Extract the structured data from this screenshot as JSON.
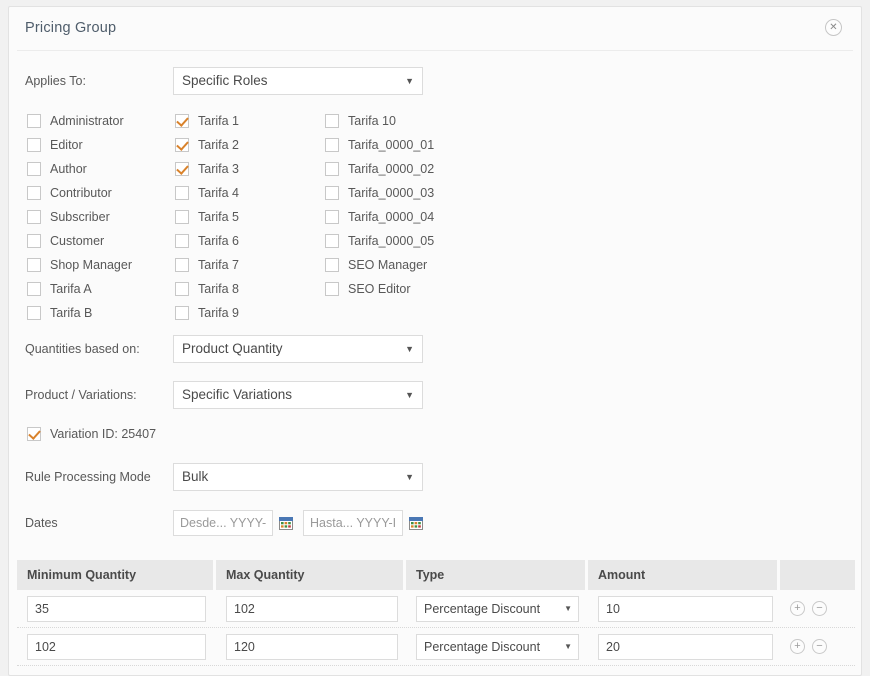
{
  "panel": {
    "title": "Pricing Group",
    "close_icon": "close-circle-icon"
  },
  "form": {
    "applies_to": {
      "label": "Applies To:",
      "value": "Specific Roles"
    },
    "quantities_based_on": {
      "label": "Quantities based on:",
      "value": "Product Quantity"
    },
    "product_variations": {
      "label": "Product / Variations:",
      "value": "Specific Variations"
    },
    "rule_processing_mode": {
      "label": "Rule Processing Mode",
      "value": "Bulk"
    },
    "dates": {
      "label": "Dates",
      "from_placeholder": "Desde... YYYY-",
      "to_placeholder": "Hasta... YYYY-I",
      "calendar_icon": "calendar-icon"
    },
    "variation": {
      "label": "Variation ID: 25407",
      "checked": true
    }
  },
  "roles": {
    "column_1": [
      {
        "label": "Administrator",
        "checked": false
      },
      {
        "label": "Editor",
        "checked": false
      },
      {
        "label": "Author",
        "checked": false
      },
      {
        "label": "Contributor",
        "checked": false
      },
      {
        "label": "Subscriber",
        "checked": false
      },
      {
        "label": "Customer",
        "checked": false
      },
      {
        "label": "Shop Manager",
        "checked": false
      },
      {
        "label": "Tarifa A",
        "checked": false
      },
      {
        "label": "Tarifa B",
        "checked": false
      }
    ],
    "column_2": [
      {
        "label": "Tarifa 1",
        "checked": true
      },
      {
        "label": "Tarifa 2",
        "checked": true
      },
      {
        "label": "Tarifa 3",
        "checked": true
      },
      {
        "label": "Tarifa 4",
        "checked": false
      },
      {
        "label": "Tarifa 5",
        "checked": false
      },
      {
        "label": "Tarifa 6",
        "checked": false
      },
      {
        "label": "Tarifa 7",
        "checked": false
      },
      {
        "label": "Tarifa 8",
        "checked": false
      },
      {
        "label": "Tarifa 9",
        "checked": false
      }
    ],
    "column_3": [
      {
        "label": "Tarifa 10",
        "checked": false
      },
      {
        "label": "Tarifa_0000_01",
        "checked": false
      },
      {
        "label": "Tarifa_0000_02",
        "checked": false
      },
      {
        "label": "Tarifa_0000_03",
        "checked": false
      },
      {
        "label": "Tarifa_0000_04",
        "checked": false
      },
      {
        "label": "Tarifa_0000_05",
        "checked": false
      },
      {
        "label": "SEO Manager",
        "checked": false
      },
      {
        "label": "SEO Editor",
        "checked": false
      }
    ]
  },
  "rules_table": {
    "headers": [
      "Minimum Quantity",
      "Max Quantity",
      "Type",
      "Amount",
      ""
    ],
    "rows": [
      {
        "min_quantity": "35",
        "max_quantity": "102",
        "type": "Percentage Discount",
        "amount": "10",
        "add_icon": "plus-circle-icon",
        "remove_icon": "minus-circle-icon"
      },
      {
        "min_quantity": "102",
        "max_quantity": "120",
        "type": "Percentage Discount",
        "amount": "20",
        "add_icon": "plus-circle-icon",
        "remove_icon": "minus-circle-icon"
      }
    ]
  },
  "colors": {
    "accent": "#d9822b",
    "panel_bg": "#fbfbfb",
    "page_bg": "#f1f1f1",
    "header_bg": "#e8e8e8"
  }
}
